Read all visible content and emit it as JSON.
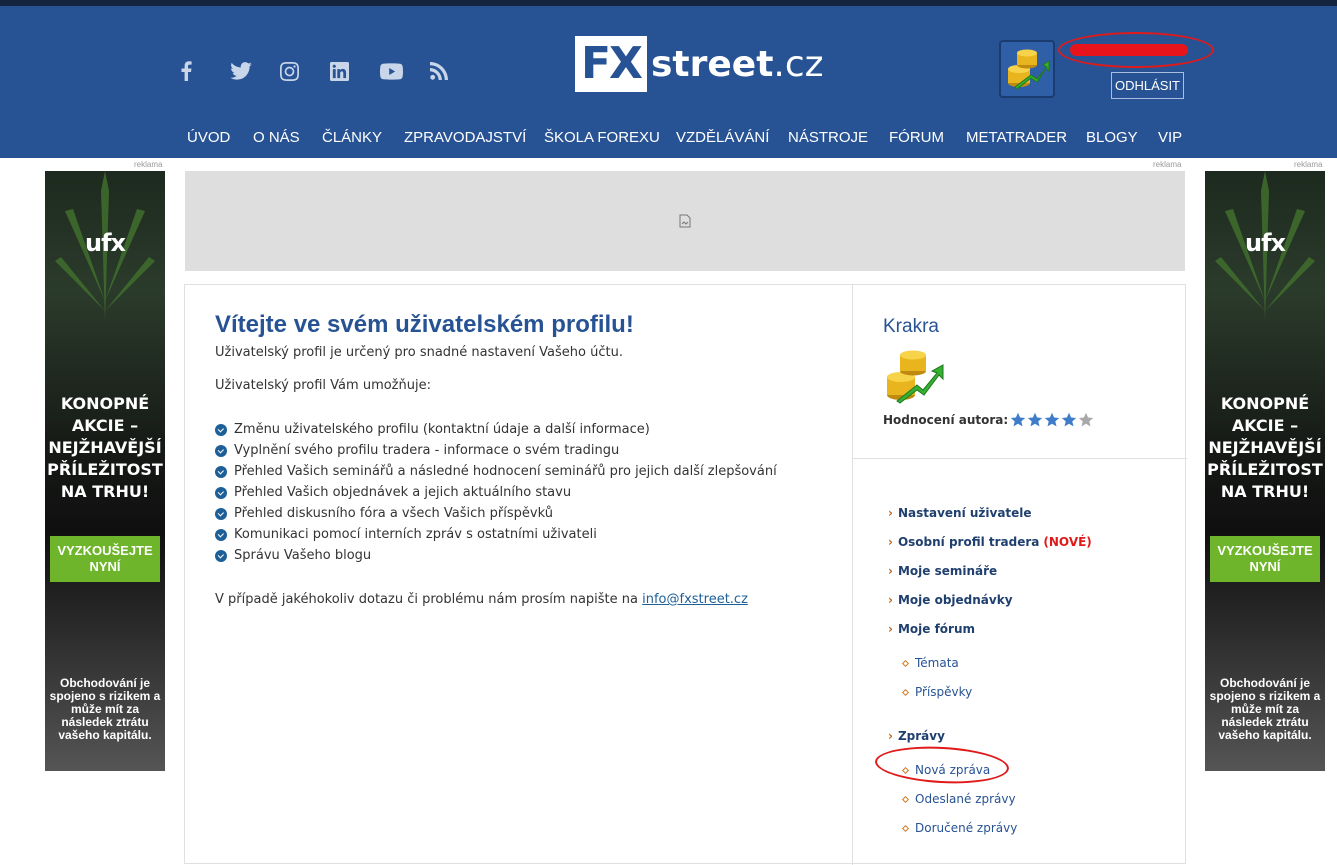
{
  "header": {
    "social_icons": [
      "facebook-icon",
      "twitter-icon",
      "instagram-icon",
      "linkedin-icon",
      "youtube-icon",
      "rss-icon"
    ],
    "logo": {
      "fx": "FX",
      "street": "street",
      "tld": ".cz"
    },
    "logout_label": "ODHLÁSIT",
    "nav": [
      "ÚVOD",
      "O NÁS",
      "ČLÁNKY",
      "ZPRAVODAJSTVÍ",
      "ŠKOLA FOREXU",
      "VZDĚLÁVÁNÍ",
      "NÁSTROJE",
      "FÓRUM",
      "METATRADER",
      "BLOGY",
      "VIP"
    ]
  },
  "ads": {
    "label": "reklama",
    "side": {
      "brand": "ufx",
      "headline": "KONOPNÉ AKCIE – NEJŽHAVĚJŠÍ PŘÍLEŽITOST NA TRHU!",
      "cta": "VYZKOUŠEJTE NYNÍ",
      "disclaimer": "Obchodování je spojeno s rizikem a může mít za následek ztrátu vašeho kapitálu."
    }
  },
  "welcome": {
    "title": "Vítejte ve svém uživatelském profilu!",
    "intro": "Uživatelský profil je určený pro snadné nastavení Vašeho účtu.",
    "enables": "Uživatelský profil Vám umožňuje:",
    "features": [
      "Změnu uživatelského profilu (kontaktní údaje a další informace)",
      "Vyplnění svého profilu tradera - informace o svém tradingu",
      "Přehled Vašich seminářů a následné hodnocení seminářů pro jejich další zlepšování",
      "Přehled Vašich objednávek a jejich aktuálního stavu",
      "Přehled diskusního fóra a všech Vašich příspěvků",
      "Komunikaci pomocí interních zpráv s ostatními uživateli",
      "Správu Vašeho blogu"
    ],
    "contact_text": "V případě jakéhokoliv dotazu či problému nám prosím napište na",
    "contact_email": "info@fxstreet.cz"
  },
  "author": {
    "name": "Krakra",
    "rating_label": "Hodnocení autora:",
    "rating": 4,
    "rating_max": 5
  },
  "menu": {
    "settings": "Nastavení uživatele",
    "trader_profile": "Osobní profil tradera",
    "new_tag": "(NOVÉ)",
    "seminars": "Moje semináře",
    "orders": "Moje objednávky",
    "forum": "Moje fórum",
    "topics": "Témata",
    "posts": "Příspěvky",
    "messages": "Zprávy",
    "new_message": "Nová zpráva",
    "sent": "Odeslané zprávy",
    "received": "Doručené zprávy"
  },
  "colors": {
    "header_bg": "#275394",
    "accent_green": "#6fb52c",
    "annotation_red": "#e01a1a"
  }
}
